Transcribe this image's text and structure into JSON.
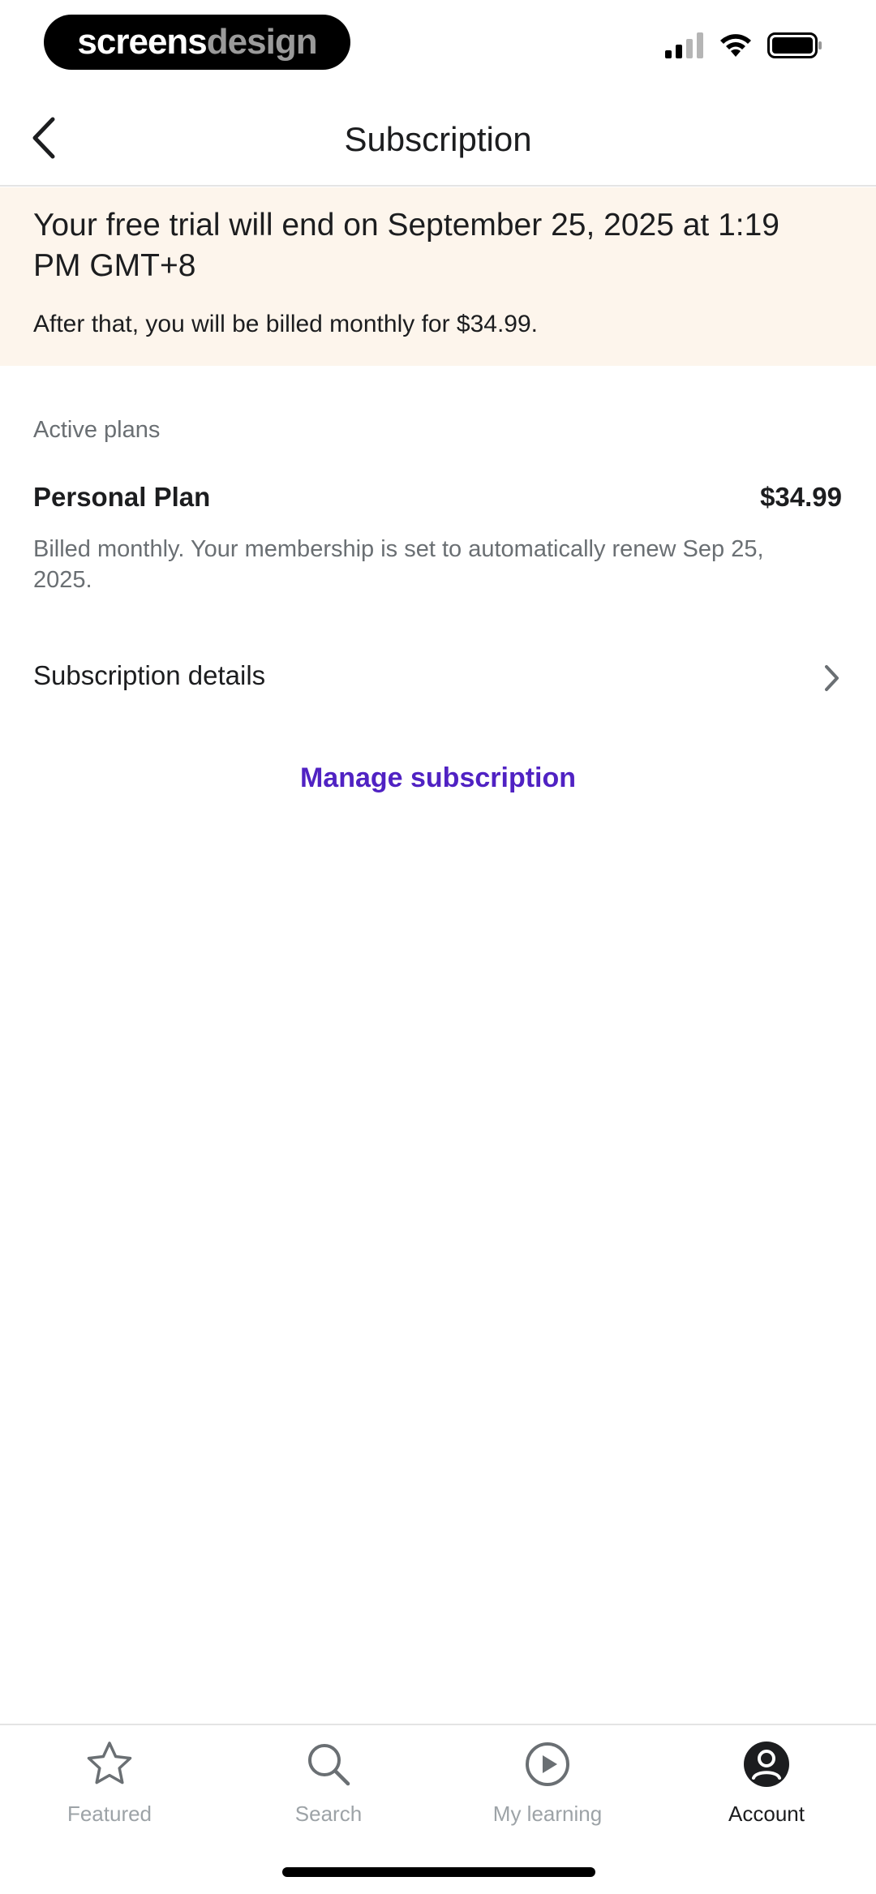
{
  "status_bar": {
    "brand_part1": "screens",
    "brand_part2": "design"
  },
  "nav": {
    "title": "Subscription"
  },
  "banner": {
    "heading": "Your free trial will end on September 25, 2025 at 1:19 PM GMT+8",
    "subtext": "After that, you will be billed monthly for $34.99."
  },
  "plans": {
    "section_label": "Active plans",
    "plan_name": "Personal Plan",
    "plan_price": "$34.99",
    "plan_description": "Billed monthly. Your membership is set to automatically renew Sep 25, 2025."
  },
  "details": {
    "label": "Subscription details"
  },
  "manage": {
    "label": "Manage subscription"
  },
  "colors": {
    "accent": "#5022c3",
    "banner_bg": "#fdf5ec",
    "text": "#1c1d1f",
    "muted": "#6a6f73"
  },
  "tabs": [
    {
      "label": "Featured",
      "icon": "star-icon",
      "active": false
    },
    {
      "label": "Search",
      "icon": "search-icon",
      "active": false
    },
    {
      "label": "My learning",
      "icon": "play-circle-icon",
      "active": false
    },
    {
      "label": "Account",
      "icon": "account-icon",
      "active": true
    }
  ]
}
